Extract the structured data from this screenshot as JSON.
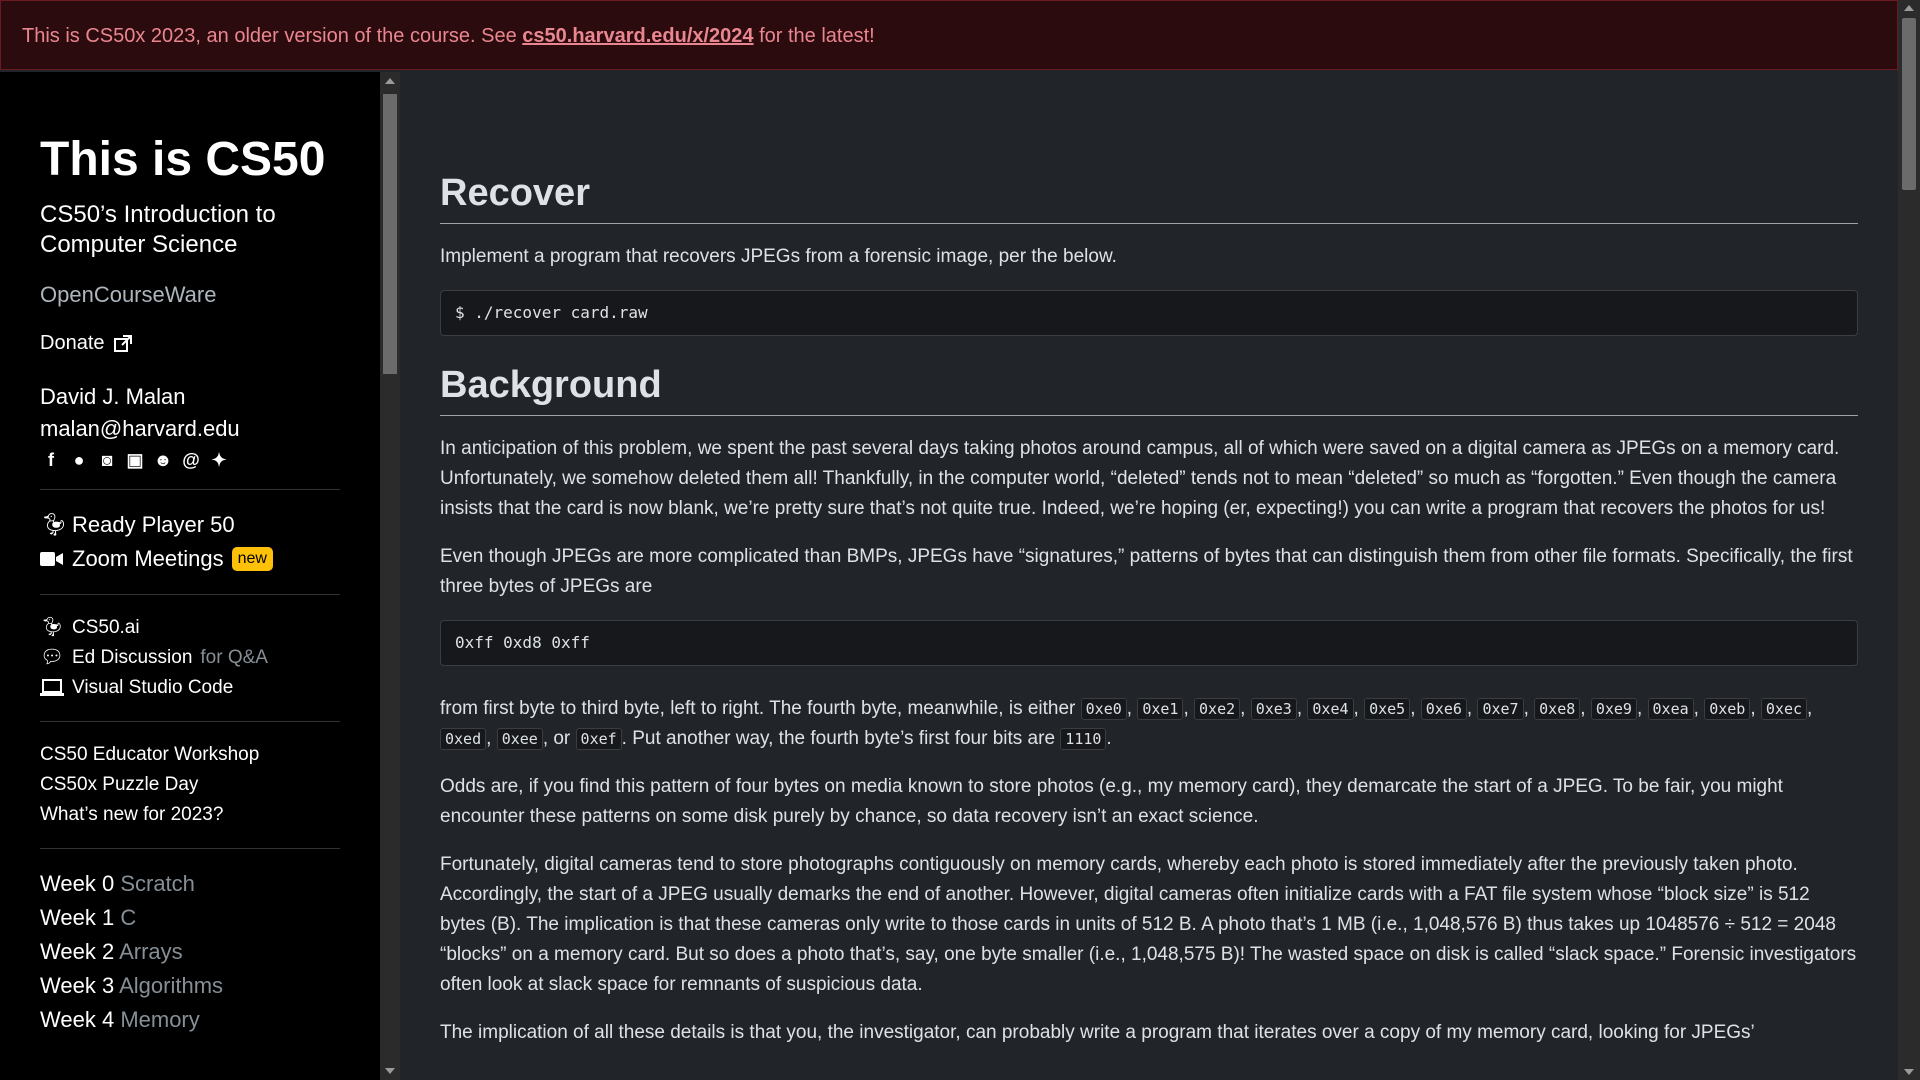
{
  "banner": {
    "prefix": "This is CS50x 2023, an older version of the course. See ",
    "link": "cs50.harvard.edu/x/2024",
    "suffix": " for the latest!"
  },
  "sidebar": {
    "title": "This is CS50",
    "subtitle": "CS50’s Introduction to Computer Science",
    "ocw": "OpenCourseWare",
    "donate": "Donate",
    "author": "David J. Malan",
    "email": "malan@harvard.edu",
    "social_icons": [
      "facebook-icon",
      "github-icon",
      "instagram-icon",
      "linkedin-icon",
      "reddit-icon",
      "threads-icon",
      "twitter-icon"
    ],
    "group1": [
      {
        "label": "Ready Player 50",
        "icon": "duck-icon"
      },
      {
        "label": "Zoom Meetings",
        "icon": "video-camera-icon",
        "badge": "new"
      }
    ],
    "group2": [
      {
        "label": "CS50.ai",
        "icon": "duck-icon"
      },
      {
        "label": "Ed Discussion",
        "muted": "for Q&A",
        "icon": "chat-icon"
      },
      {
        "label": "Visual Studio Code",
        "icon": "laptop-icon"
      }
    ],
    "group3": [
      "CS50 Educator Workshop",
      "CS50x Puzzle Day",
      "What’s new for 2023?"
    ],
    "weeks": [
      {
        "label": "Week 0",
        "topic": "Scratch"
      },
      {
        "label": "Week 1",
        "topic": "C"
      },
      {
        "label": "Week 2",
        "topic": "Arrays"
      },
      {
        "label": "Week 3",
        "topic": "Algorithms"
      },
      {
        "label": "Week 4",
        "topic": "Memory"
      }
    ]
  },
  "main": {
    "h1": "Recover",
    "intro": "Implement a program that recovers JPEGs from a forensic image, per the below.",
    "cmd": "$ ./recover card.raw",
    "h2": "Background",
    "p1": "In anticipation of this problem, we spent the past several days taking photos around campus, all of which were saved on a digital camera as JPEGs on a memory card. Unfortunately, we somehow deleted them all! Thankfully, in the computer world, “deleted” tends not to mean “deleted” so much as “forgotten.” Even though the camera insists that the card is now blank, we’re pretty sure that’s not quite true. Indeed, we’re hoping (er, expecting!) you can write a program that recovers the photos for us!",
    "p2": "Even though JPEGs are more complicated than BMPs, JPEGs have “signatures,” patterns of bytes that can distinguish them from other file formats. Specifically, the first three bytes of JPEGs are",
    "bytes": "0xff 0xd8 0xff",
    "p3_a": "from first byte to third byte, left to right. The fourth byte, meanwhile, is either ",
    "fourth_bytes": [
      "0xe0",
      "0xe1",
      "0xe2",
      "0xe3",
      "0xe4",
      "0xe5",
      "0xe6",
      "0xe7",
      "0xe8",
      "0xe9",
      "0xea",
      "0xeb",
      "0xec",
      "0xed",
      "0xee",
      "0xef"
    ],
    "p3_or": "or",
    "p3_b": ". Put another way, the fourth byte’s first four bits are ",
    "bits": "1110",
    "p3_end": ".",
    "p4": "Odds are, if you find this pattern of four bytes on media known to store photos (e.g., my memory card), they demarcate the start of a JPEG. To be fair, you might encounter these patterns on some disk purely by chance, so data recovery isn’t an exact science.",
    "p5": "Fortunately, digital cameras tend to store photographs contiguously on memory cards, whereby each photo is stored immediately after the previously taken photo. Accordingly, the start of a JPEG usually demarks the end of another. However, digital cameras often initialize cards with a FAT file system whose “block size” is 512 bytes (B). The implication is that these cameras only write to those cards in units of 512 B. A photo that’s 1 MB (i.e., 1,048,576 B) thus takes up 1048576 ÷ 512 = 2048 “blocks” on a memory card. But so does a photo that’s, say, one byte smaller (i.e., 1,048,575 B)! The wasted space on disk is called “slack space.” Forensic investigators often look at slack space for remnants of suspicious data.",
    "p6": "The implication of all these details is that you, the investigator, can probably write a program that iterates over a copy of my memory card, looking for JPEGs’"
  }
}
